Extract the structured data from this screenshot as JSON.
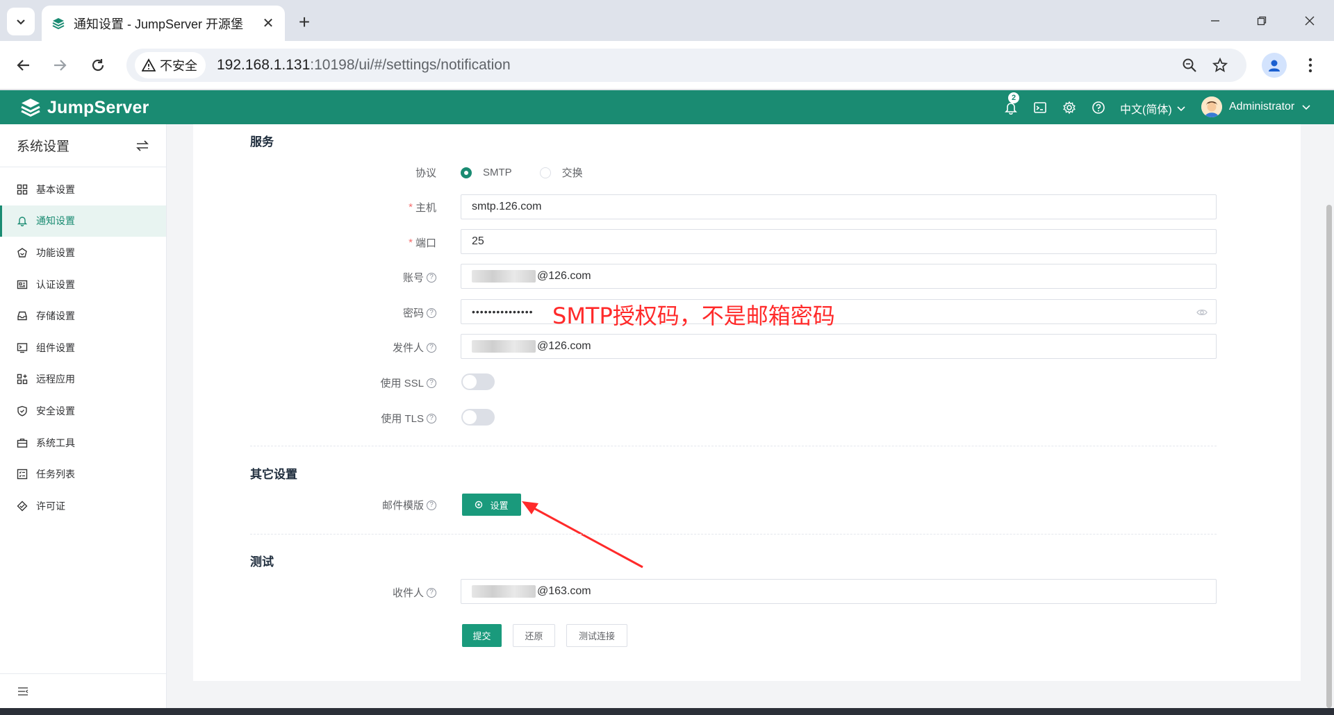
{
  "browser": {
    "tab_title": "通知设置 - JumpServer 开源堡",
    "insecure_label": "不安全",
    "url_host": "192.168.1.131",
    "url_path": ":10198/ui/#/settings/notification"
  },
  "header": {
    "logo_text": "JumpServer",
    "notify_count": "2",
    "language": "中文(简体)",
    "user": "Administrator"
  },
  "sidebar": {
    "title": "系统设置",
    "items": [
      {
        "label": "基本设置",
        "icon": "grid-icon"
      },
      {
        "label": "通知设置",
        "icon": "bell-icon",
        "active": true
      },
      {
        "label": "功能设置",
        "icon": "feature-icon"
      },
      {
        "label": "认证设置",
        "icon": "id-card-icon"
      },
      {
        "label": "存储设置",
        "icon": "storage-icon"
      },
      {
        "label": "组件设置",
        "icon": "terminal-icon"
      },
      {
        "label": "远程应用",
        "icon": "apps-icon"
      },
      {
        "label": "安全设置",
        "icon": "shield-icon"
      },
      {
        "label": "系统工具",
        "icon": "toolbox-icon"
      },
      {
        "label": "任务列表",
        "icon": "task-list-icon"
      },
      {
        "label": "许可证",
        "icon": "license-icon"
      }
    ]
  },
  "form": {
    "section_service": "服务",
    "protocol_label": "协议",
    "protocol_options": [
      "SMTP",
      "交换"
    ],
    "host_label": "主机",
    "host_value": "smtp.126.com",
    "port_label": "端口",
    "port_value": "25",
    "account_label": "账号",
    "account_value": "@126.com",
    "password_label": "密码",
    "password_value": "•••••••••••••••",
    "sender_label": "发件人",
    "sender_value": "@126.com",
    "ssl_label": "使用 SSL",
    "tls_label": "使用 TLS",
    "section_other": "其它设置",
    "template_label": "邮件模版",
    "template_button": "设置",
    "section_test": "测试",
    "recipient_label": "收件人",
    "recipient_value": "@163.com",
    "submit_button": "提交",
    "reset_button": "还原",
    "test_button": "测试连接"
  },
  "annotation": {
    "text": "SMTP授权码，不是邮箱密码",
    "color": "#ff2a2a"
  },
  "colors": {
    "brand": "#1a8b72",
    "primary_button": "#1a9a7c"
  }
}
